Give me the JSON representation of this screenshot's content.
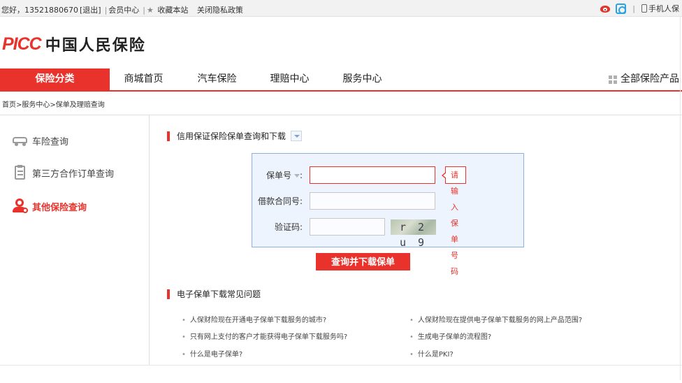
{
  "topbar": {
    "greeting": "您好，13521880670",
    "logout": "[退出]",
    "member": "会员中心",
    "bookmark": "收藏本站",
    "privacy": "关闭隐私政策",
    "mobile": "手机人保"
  },
  "logo": {
    "brand": "PICC",
    "name": "中国人民保险"
  },
  "nav": {
    "items": [
      "保险分类",
      "商城首页",
      "汽车保险",
      "理赔中心",
      "服务中心"
    ],
    "all_products": "全部保险产品"
  },
  "breadcrumb": "首页>服务中心>保单及理赔查询",
  "sidebar": {
    "items": [
      "车险查询",
      "第三方合作订单查询",
      "其他保险查询"
    ]
  },
  "query": {
    "title": "信用保证保险保单查询和下载",
    "policy_label": "保单号",
    "policy_tip": "请输入保单号码",
    "contract_label": "借款合同号:",
    "captcha_label": "验证码:",
    "captcha_text": "r 2 u 9",
    "submit": "查询并下载保单"
  },
  "faq": {
    "title": "电子保单下载常见问题",
    "left": [
      "人保财险现在开通电子保单下载服务的城市?",
      "只有网上支付的客户才能获得电子保单下载服务吗?",
      "什么是电子保单?"
    ],
    "right": [
      "人保财险现在提供电子保单下载服务的网上产品范围?",
      "生成电子保单的流程图?",
      "什么是PKI?"
    ]
  },
  "colors": {
    "brand_red": "#e8322b",
    "form_bg": "#eef4fd",
    "form_border": "#8fb0dc"
  }
}
